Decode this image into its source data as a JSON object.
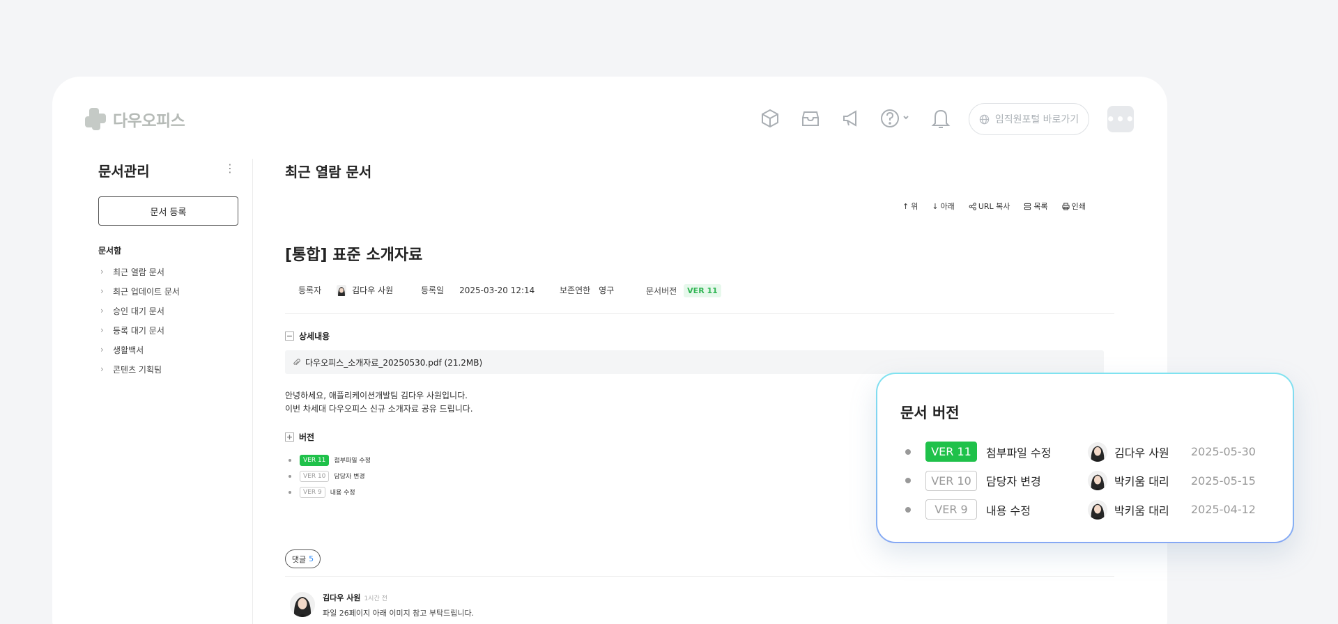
{
  "header": {
    "logo_text": "다우오피스",
    "portal_label": "임직원포털 바로가기",
    "more_label": "•••"
  },
  "sidebar": {
    "title": "문서관리",
    "register_button": "문서 등록",
    "section_label": "문서함",
    "items": [
      {
        "label": "최근 열람 문서"
      },
      {
        "label": "최근 업데이트 문서"
      },
      {
        "label": "승인 대기 문서"
      },
      {
        "label": "등록 대기 문서"
      },
      {
        "label": "생활백서"
      },
      {
        "label": "콘텐츠 기획팀"
      }
    ]
  },
  "main": {
    "title": "최근 열람 문서",
    "toolbar": {
      "up": "위",
      "down": "아래",
      "url_copy": "URL 복사",
      "list": "목록",
      "print": "인쇄"
    },
    "doc_title": "[통합] 표준 소개자료",
    "meta": {
      "author_label": "등록자",
      "author": "김다우 사원",
      "date_label": "등록일",
      "date": "2025-03-20 12:14",
      "retention_label": "보존연한",
      "retention": "영구",
      "version_label": "문서버전",
      "version": "VER 11"
    },
    "detail_label": "상세내용",
    "attachment": "다우오피스_소개자료_20250530.pdf (21.2MB)",
    "body_lines": [
      "안녕하세요, 애플리케이션개발팀 김다우 사원입니다.",
      "이번 차세대 다우오피스 신규 소개자료 공유 드립니다."
    ],
    "version_section_label": "버전",
    "versions": [
      {
        "tag": "VER 11",
        "desc": "첨부파일 수정",
        "active": true
      },
      {
        "tag": "VER 10",
        "desc": "담당자 변경",
        "active": false
      },
      {
        "tag": "VER 9",
        "desc": "내용 수정",
        "active": false
      }
    ],
    "comments_label": "댓글",
    "comments_count": "5",
    "comment": {
      "name": "김다우 사원",
      "time": "1시간 전",
      "text": "파일 26페이지 아래 이미지 참고 부탁드립니다."
    }
  },
  "version_card": {
    "title": "문서 버전",
    "rows": [
      {
        "tag": "VER 11",
        "desc": "첨부파일 수정",
        "user": "김다우 사원",
        "date": "2025-05-30",
        "active": true
      },
      {
        "tag": "VER 10",
        "desc": "담당자 변경",
        "user": "박키움 대리",
        "date": "2025-05-15",
        "active": false
      },
      {
        "tag": "VER 9",
        "desc": "내용 수정",
        "user": "박키움 대리",
        "date": "2025-04-12",
        "active": false
      }
    ]
  },
  "colors": {
    "accent_green": "#1fc14a",
    "comment_count_blue": "#2e8af6",
    "card_border_top": "#7fe3f0",
    "card_border_bottom": "#86a8f4"
  }
}
